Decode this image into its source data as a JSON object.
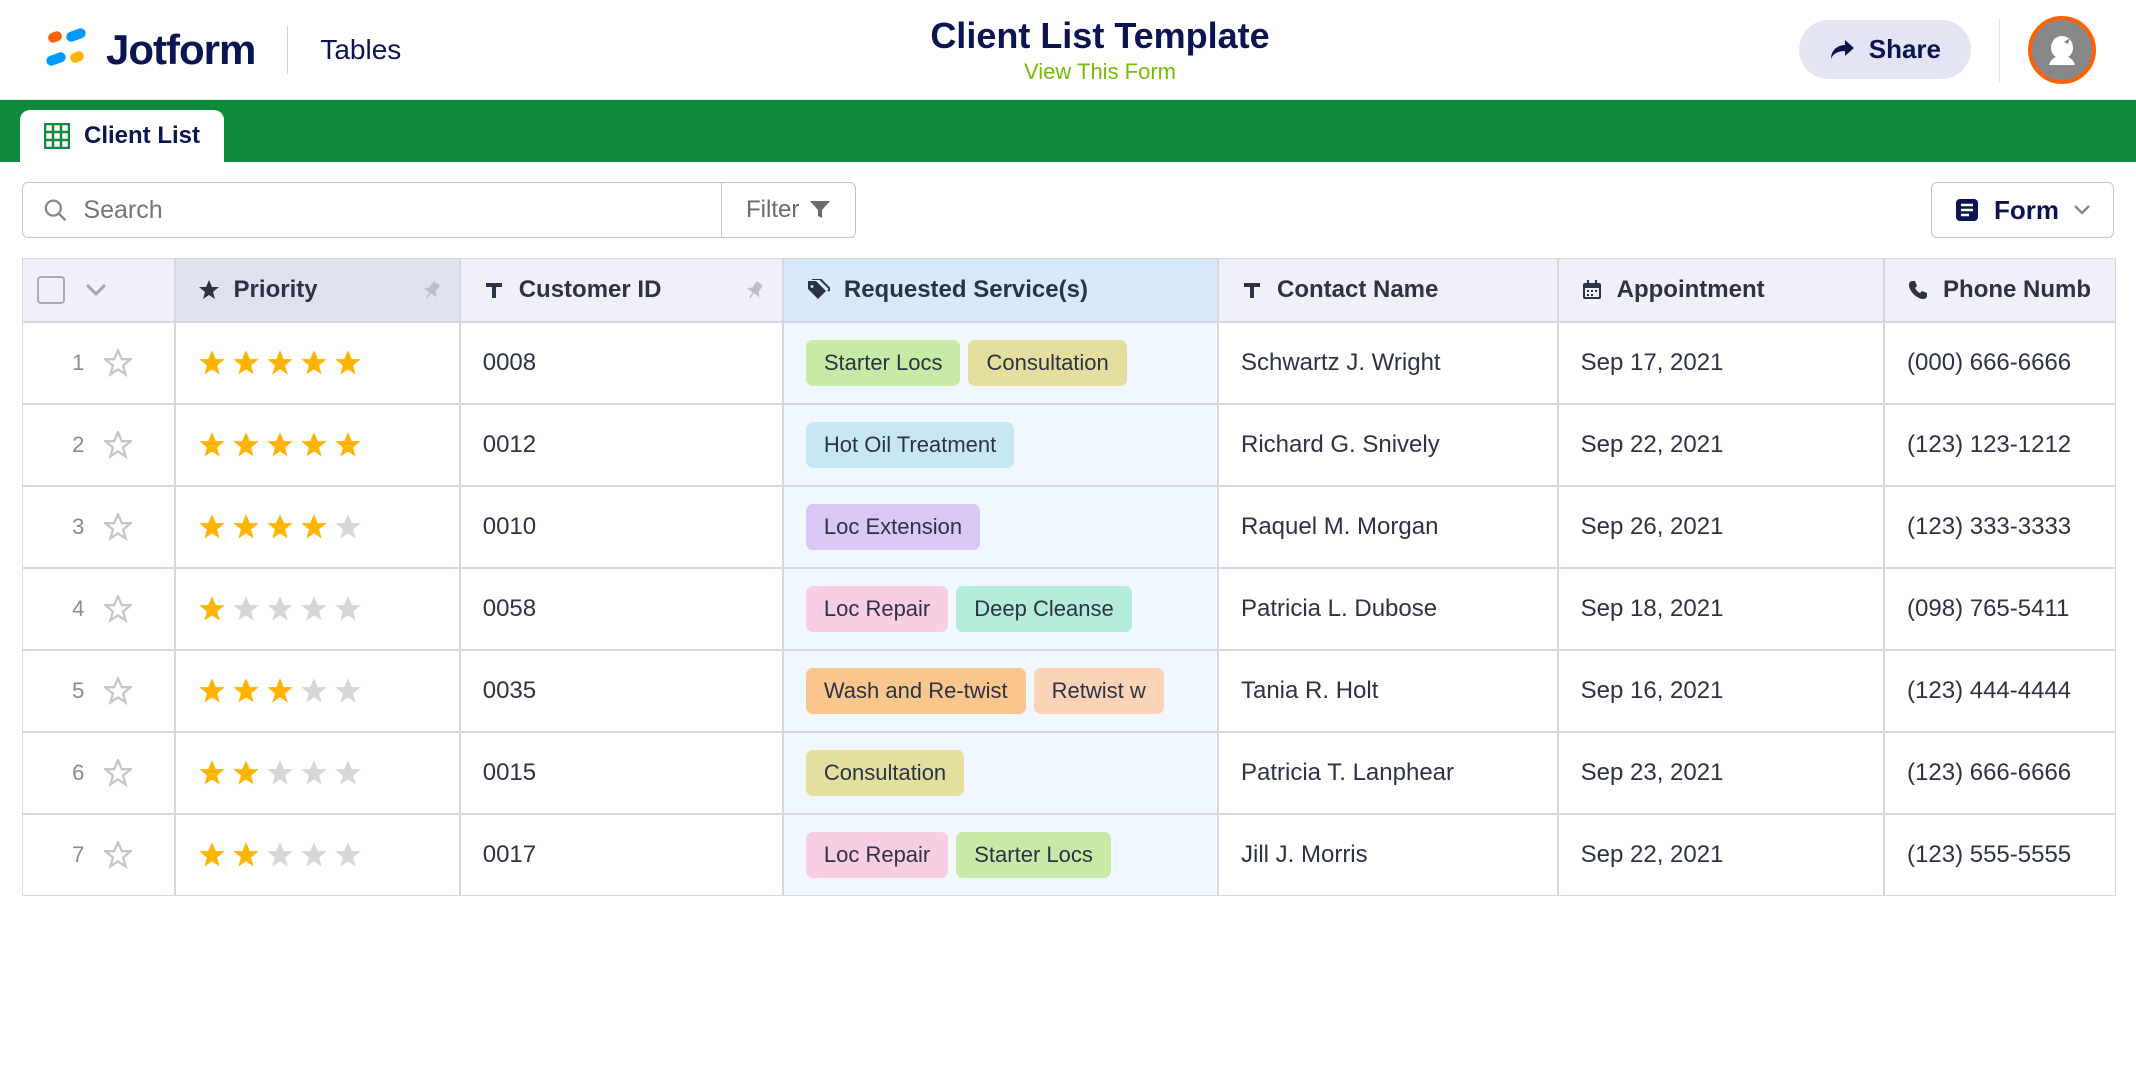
{
  "header": {
    "logo_text": "Jotform",
    "tables_label": "Tables",
    "title": "Client List Template",
    "subtitle": "View This Form",
    "share_label": "Share"
  },
  "tabs": {
    "active": "Client List"
  },
  "toolbar": {
    "search_placeholder": "Search",
    "filter_label": "Filter",
    "form_label": "Form"
  },
  "columns": {
    "priority": "Priority",
    "customer_id": "Customer ID",
    "services": "Requested Service(s)",
    "contact": "Contact Name",
    "appointment": "Appointment",
    "phone": "Phone Numb"
  },
  "service_colors": {
    "Starter Locs": "tag-green",
    "Consultation": "tag-olive",
    "Hot Oil Treatment": "tag-blue",
    "Loc Extension": "tag-purple",
    "Loc Repair": "tag-pink",
    "Deep Cleanse": "tag-teal",
    "Wash and Re-twist": "tag-orange",
    "Retwist w": "tag-peach"
  },
  "rows": [
    {
      "num": "1",
      "stars": 5,
      "id": "0008",
      "services": [
        "Starter Locs",
        "Consultation"
      ],
      "contact": "Schwartz J. Wright",
      "appt": "Sep 17, 2021",
      "phone": "(000) 666-6666"
    },
    {
      "num": "2",
      "stars": 5,
      "id": "0012",
      "services": [
        "Hot Oil Treatment"
      ],
      "contact": "Richard G. Snively",
      "appt": "Sep 22, 2021",
      "phone": "(123) 123-1212"
    },
    {
      "num": "3",
      "stars": 4,
      "id": "0010",
      "services": [
        "Loc Extension"
      ],
      "contact": "Raquel M. Morgan",
      "appt": "Sep 26, 2021",
      "phone": "(123) 333-3333"
    },
    {
      "num": "4",
      "stars": 1,
      "id": "0058",
      "services": [
        "Loc Repair",
        "Deep Cleanse"
      ],
      "contact": "Patricia L. Dubose",
      "appt": "Sep 18, 2021",
      "phone": "(098) 765-5411"
    },
    {
      "num": "5",
      "stars": 3,
      "id": "0035",
      "services": [
        "Wash and Re-twist",
        "Retwist w"
      ],
      "contact": "Tania R. Holt",
      "appt": "Sep 16, 2021",
      "phone": "(123) 444-4444"
    },
    {
      "num": "6",
      "stars": 2,
      "id": "0015",
      "services": [
        "Consultation"
      ],
      "contact": "Patricia T. Lanphear",
      "appt": "Sep 23, 2021",
      "phone": "(123) 666-6666"
    },
    {
      "num": "7",
      "stars": 2,
      "id": "0017",
      "services": [
        "Loc Repair",
        "Starter Locs"
      ],
      "contact": "Jill J. Morris",
      "appt": "Sep 22, 2021",
      "phone": "(123) 555-5555"
    }
  ]
}
